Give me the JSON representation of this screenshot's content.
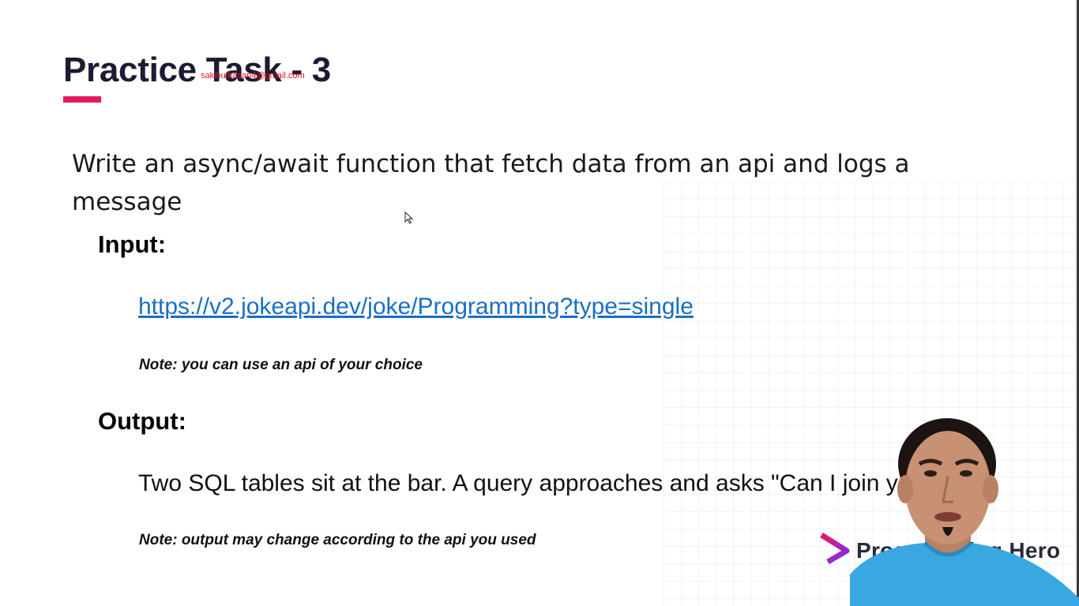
{
  "slide": {
    "title": "Practice Task - 3",
    "watermark": "sakibulhasan4@gmail.com",
    "description": "Write an async/await function that fetch data from an api and logs a message",
    "input_label": "Input:",
    "input_url": "https://v2.jokeapi.dev/joke/Programming?type=single",
    "input_note": "Note: you can use an api of your choice",
    "output_label": "Output:",
    "output_text": "Two SQL tables sit at the bar. A query approaches and asks \"Can I join you?\"",
    "output_note": "Note: output may change according to the api you used"
  },
  "brand": {
    "name": "Programming Hero",
    "logo_icon": "programming-hero-logo-icon"
  },
  "overlay": {
    "webcam": "presenter-webcam",
    "cursor_icon": "mouse-pointer-icon"
  },
  "colors": {
    "title": "#1c1b33",
    "accent_bar": "#e5195e",
    "link": "#1a6fc4",
    "watermark": "#e3141b",
    "brand_gradient": [
      "#e5195e",
      "#7b2ff7"
    ],
    "presenter_shirt": "#3aa8e0"
  }
}
